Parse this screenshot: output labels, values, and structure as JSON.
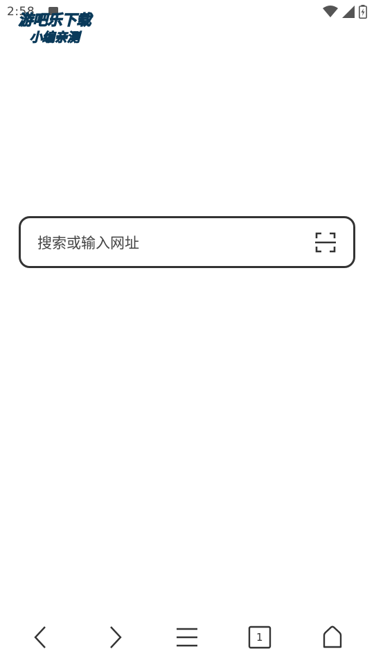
{
  "status_bar": {
    "time": "2:58",
    "icons": [
      "notification-icon",
      "wifi-icon",
      "signal-icon",
      "battery-charging-icon"
    ]
  },
  "watermark": {
    "line1": "游吧乐下载",
    "line2": "小编亲测"
  },
  "search": {
    "placeholder": "搜索或输入网址",
    "scan_icon": "scan-icon"
  },
  "bottom_nav": {
    "items": [
      {
        "icon": "back-arrow-icon"
      },
      {
        "icon": "forward-arrow-icon"
      },
      {
        "icon": "menu-icon"
      },
      {
        "icon": "tabs-icon",
        "count": "1"
      },
      {
        "icon": "home-icon"
      }
    ]
  },
  "colors": {
    "foreground": "#333333",
    "background": "#ffffff",
    "watermark_fill": "#3ad0f0"
  }
}
